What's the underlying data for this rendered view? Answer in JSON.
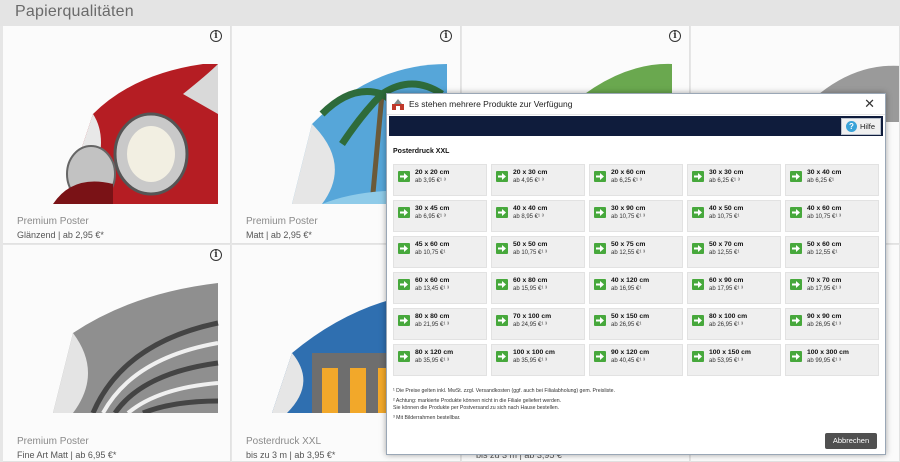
{
  "page": {
    "title": "Papierqualitäten"
  },
  "cards": [
    {
      "name": "Premium Poster",
      "sub": "Glänzend | ab 2,95 €*"
    },
    {
      "name": "Premium Poster",
      "sub": "Matt | ab 2,95 €*"
    },
    {
      "name": "Premium Poster",
      "sub": "Fine Art Matt | ab 6,95 €*"
    },
    {
      "name": "Posterdruck XXL",
      "sub": "bis zu 3 m | ab 3,95 €*"
    },
    {
      "sub": "bis zu 3 m | ab 3,95 €*"
    }
  ],
  "info_glyph": "i",
  "modal": {
    "title": "Es stehen mehrere Produkte zur Verfügung",
    "close": "✕",
    "help_label": "Hilfe",
    "help_glyph": "?",
    "section": "Posterdruck XXL",
    "cancel_label": "Abbrechen",
    "notes": [
      "¹ Die Preise gelten inkl. MwSt. zzgl. Versandkosten (ggf. auch bei Filialabholung) gem. Preisliste.",
      "² Achtung: markierte Produkte können nicht in die Filiale geliefert werden.",
      "Sie können die Produkte per Postversand zu sich nach Hause bestellen.",
      "³ Mit Bilderrahmen bestellbar."
    ],
    "products": [
      {
        "size": "20 x 20 cm",
        "price": "ab 3,95 €¹ ³"
      },
      {
        "size": "20 x 30 cm",
        "price": "ab 4,95 €¹ ³"
      },
      {
        "size": "20 x 60 cm",
        "price": "ab 6,25 €¹ ³"
      },
      {
        "size": "30 x 30 cm",
        "price": "ab 6,25 €¹ ³"
      },
      {
        "size": "30 x 40 cm",
        "price": "ab 6,25 €¹"
      },
      {
        "size": "30 x 45 cm",
        "price": "ab 6,95 €¹ ³"
      },
      {
        "size": "40 x 40 cm",
        "price": "ab 8,95 €¹ ³"
      },
      {
        "size": "30 x 90 cm",
        "price": "ab 10,75 €¹ ³"
      },
      {
        "size": "40 x 50 cm",
        "price": "ab 10,75 €¹"
      },
      {
        "size": "40 x 60 cm",
        "price": "ab 10,75 €¹ ³"
      },
      {
        "size": "45 x 60 cm",
        "price": "ab 10,75 €¹"
      },
      {
        "size": "50 x 50 cm",
        "price": "ab 10,75 €¹ ³"
      },
      {
        "size": "50 x 75 cm",
        "price": "ab 12,55 €¹ ³"
      },
      {
        "size": "50 x 70 cm",
        "price": "ab 12,55 €¹"
      },
      {
        "size": "50 x 60 cm",
        "price": "ab 12,55 €¹"
      },
      {
        "size": "60 x 60 cm",
        "price": "ab 13,45 €¹ ³"
      },
      {
        "size": "60 x 80 cm",
        "price": "ab 15,95 €¹ ³"
      },
      {
        "size": "40 x 120 cm",
        "price": "ab 16,95 €¹"
      },
      {
        "size": "60 x 90 cm",
        "price": "ab 17,95 €¹ ³"
      },
      {
        "size": "70 x 70 cm",
        "price": "ab 17,95 €¹ ³"
      },
      {
        "size": "80 x 80 cm",
        "price": "ab 21,95 €¹ ³"
      },
      {
        "size": "70 x 100 cm",
        "price": "ab 24,95 €¹ ³"
      },
      {
        "size": "50 x 150 cm",
        "price": "ab 26,95 €¹"
      },
      {
        "size": "80 x 100 cm",
        "price": "ab 26,95 €¹ ³"
      },
      {
        "size": "90 x 90 cm",
        "price": "ab 26,95 €¹ ³"
      },
      {
        "size": "80 x 120 cm",
        "price": "ab 35,95 €¹ ³"
      },
      {
        "size": "100 x 100 cm",
        "price": "ab 35,95 €¹ ³"
      },
      {
        "size": "90 x 120 cm",
        "price": "ab 40,45 €¹ ³"
      },
      {
        "size": "100 x 150 cm",
        "price": "ab 53,95 €¹ ³"
      },
      {
        "size": "100 x 300 cm",
        "price": "ab 99,95 €¹ ³"
      }
    ]
  },
  "colors": {
    "navbar": "#0f1c3c",
    "arrow": "#47a83c",
    "cancel": "#505050",
    "help_icon": "#3aa3d8"
  },
  "icons": {
    "product_arrow": "arrow-right-icon",
    "app": "app-logo-icon",
    "close": "close-icon",
    "help": "help-icon",
    "info": "info-icon"
  }
}
